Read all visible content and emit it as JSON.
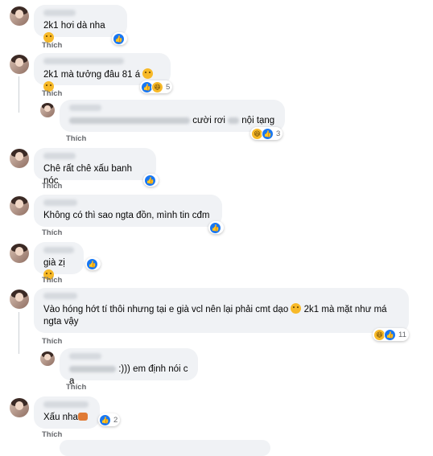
{
  "ui": {
    "like_label": "Thích",
    "colors": {
      "bubble": "#f0f2f5",
      "like_blue": "#1877f2",
      "muted": "#65676b",
      "reaction_yellow": "#f7b928"
    }
  },
  "comments": [
    {
      "id": "c1",
      "text": "2k1 hơi dà nha",
      "emoji_after_text": "sad-face",
      "reactions": [
        "like"
      ],
      "count": ""
    },
    {
      "id": "c2",
      "text": "2k1 mà tưởng đâu 81 á",
      "emoji_after_text": "grin-faces",
      "reactions": [
        "like",
        "haha"
      ],
      "count": "5"
    },
    {
      "id": "c3",
      "text_before": "",
      "text": "cười rơi",
      "text_after": "nội tạng",
      "reactions": [
        "haha",
        "like"
      ],
      "count": "3",
      "is_reply": true
    },
    {
      "id": "c4",
      "text": "Chê rất chê xấu banh nóc",
      "reactions": [
        "like"
      ],
      "count": ""
    },
    {
      "id": "c5",
      "text": "Không có thì sao ngta đồn, mình tin cđm",
      "reactions": [
        "like"
      ],
      "count": ""
    },
    {
      "id": "c6",
      "text": "già zị",
      "emoji_after_text": "sad-face",
      "reactions": [
        "like"
      ],
      "count": ""
    },
    {
      "id": "c7",
      "text_line1": "Vào hóng hớt tí thôi nhưng tại e già vcl nên lại phải cmt dạo",
      "text_line1_after": "2k1 mà mặt như má",
      "text_line2": "ngta vậy",
      "reactions": [
        "haha",
        "like"
      ],
      "count": "11"
    },
    {
      "id": "c8",
      "text": ":))) em định nói c ạ",
      "reactions": [],
      "count": "",
      "is_reply": true
    },
    {
      "id": "c9",
      "text": "Xấu nha",
      "emoji_after_text": "hands-icon",
      "reactions": [
        "like"
      ],
      "count": "2"
    }
  ]
}
